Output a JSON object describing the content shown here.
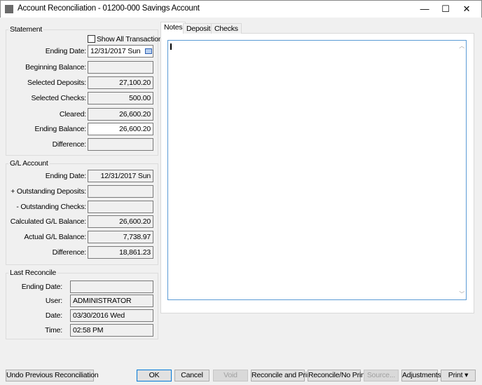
{
  "window": {
    "title": "Account Reconciliation - 01200-000 Savings Account",
    "icon": "app-chart-icon",
    "minimize": "—",
    "maximize": "☐",
    "close": "✕"
  },
  "statement": {
    "title": "Statement",
    "show_all": "Show All Transactions",
    "show_all_checked": false,
    "rows": [
      {
        "label": "Ending Date:",
        "value": "12/31/2017 Sun"
      },
      {
        "label": "Beginning Balance:",
        "value": ""
      },
      {
        "label": "Selected Deposits:",
        "value": "27,100.20"
      },
      {
        "label": "Selected Checks:",
        "value": "500.00"
      },
      {
        "label": "Cleared:",
        "value": "26,600.20"
      },
      {
        "label": "Ending Balance:",
        "value": "26,600.20"
      },
      {
        "label": "Difference:",
        "value": ""
      }
    ]
  },
  "gl": {
    "title": "G/L Account",
    "rows": [
      {
        "label": "Ending Date:",
        "value": "12/31/2017 Sun"
      },
      {
        "label": "+ Outstanding Deposits:",
        "value": ""
      },
      {
        "label": "- Outstanding Checks:",
        "value": ""
      },
      {
        "label": "Calculated G/L Balance:",
        "value": "26,600.20"
      },
      {
        "label": "Actual G/L Balance:",
        "value": "7,738.97"
      },
      {
        "label": "Difference:",
        "value": "18,861.23"
      }
    ]
  },
  "last": {
    "title": "Last Reconcile",
    "rows": [
      {
        "label": "Ending Date:",
        "value": ""
      },
      {
        "label": "User:",
        "value": "ADMINISTRATOR"
      },
      {
        "label": "Date:",
        "value": "03/30/2016 Wed"
      },
      {
        "label": "Time:",
        "value": "02:58 PM"
      }
    ]
  },
  "tabs": [
    {
      "label": "Notes",
      "active": true
    },
    {
      "label": "Deposits"
    },
    {
      "label": "Checks"
    }
  ],
  "notes": {
    "value": ""
  },
  "buttons": {
    "undo": "Undo Previous Reconciliation",
    "ok": "OK",
    "cancel": "Cancel",
    "void": "Void",
    "rec_print": "Reconcile and Print",
    "rec_noprint": "Reconcile/No Print",
    "source": "Source...",
    "adjustments": "Adjustments",
    "print": "Print ▾"
  }
}
